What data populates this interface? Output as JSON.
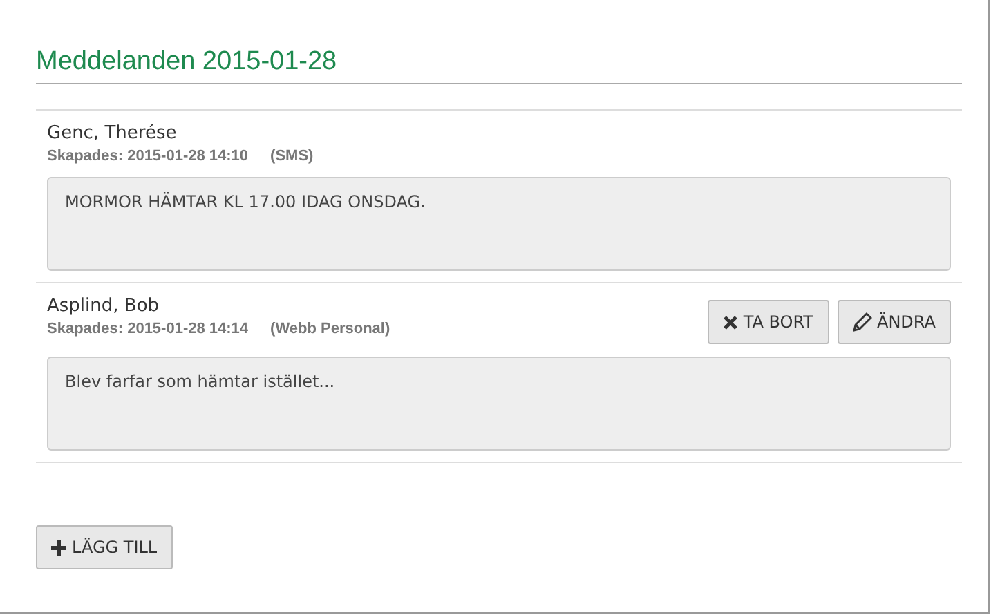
{
  "heading": "Meddelanden 2015-01-28",
  "messages": [
    {
      "author": "Genc, Therése",
      "created": "Skapades: 2015-01-28 14:10",
      "source": "(SMS)",
      "text": "MORMOR HÄMTAR KL 17.00 IDAG ONSDAG."
    },
    {
      "author": "Asplind, Bob",
      "created": "Skapades: 2015-01-28 14:14",
      "source": "(Webb Personal)",
      "text": "Blev farfar som hämtar istället...",
      "buttons": [
        {
          "kind": "delete",
          "label": "TA BORT"
        },
        {
          "kind": "edit",
          "label": "ÄNDRA"
        }
      ]
    }
  ],
  "add_button": "LÄGG TILL"
}
